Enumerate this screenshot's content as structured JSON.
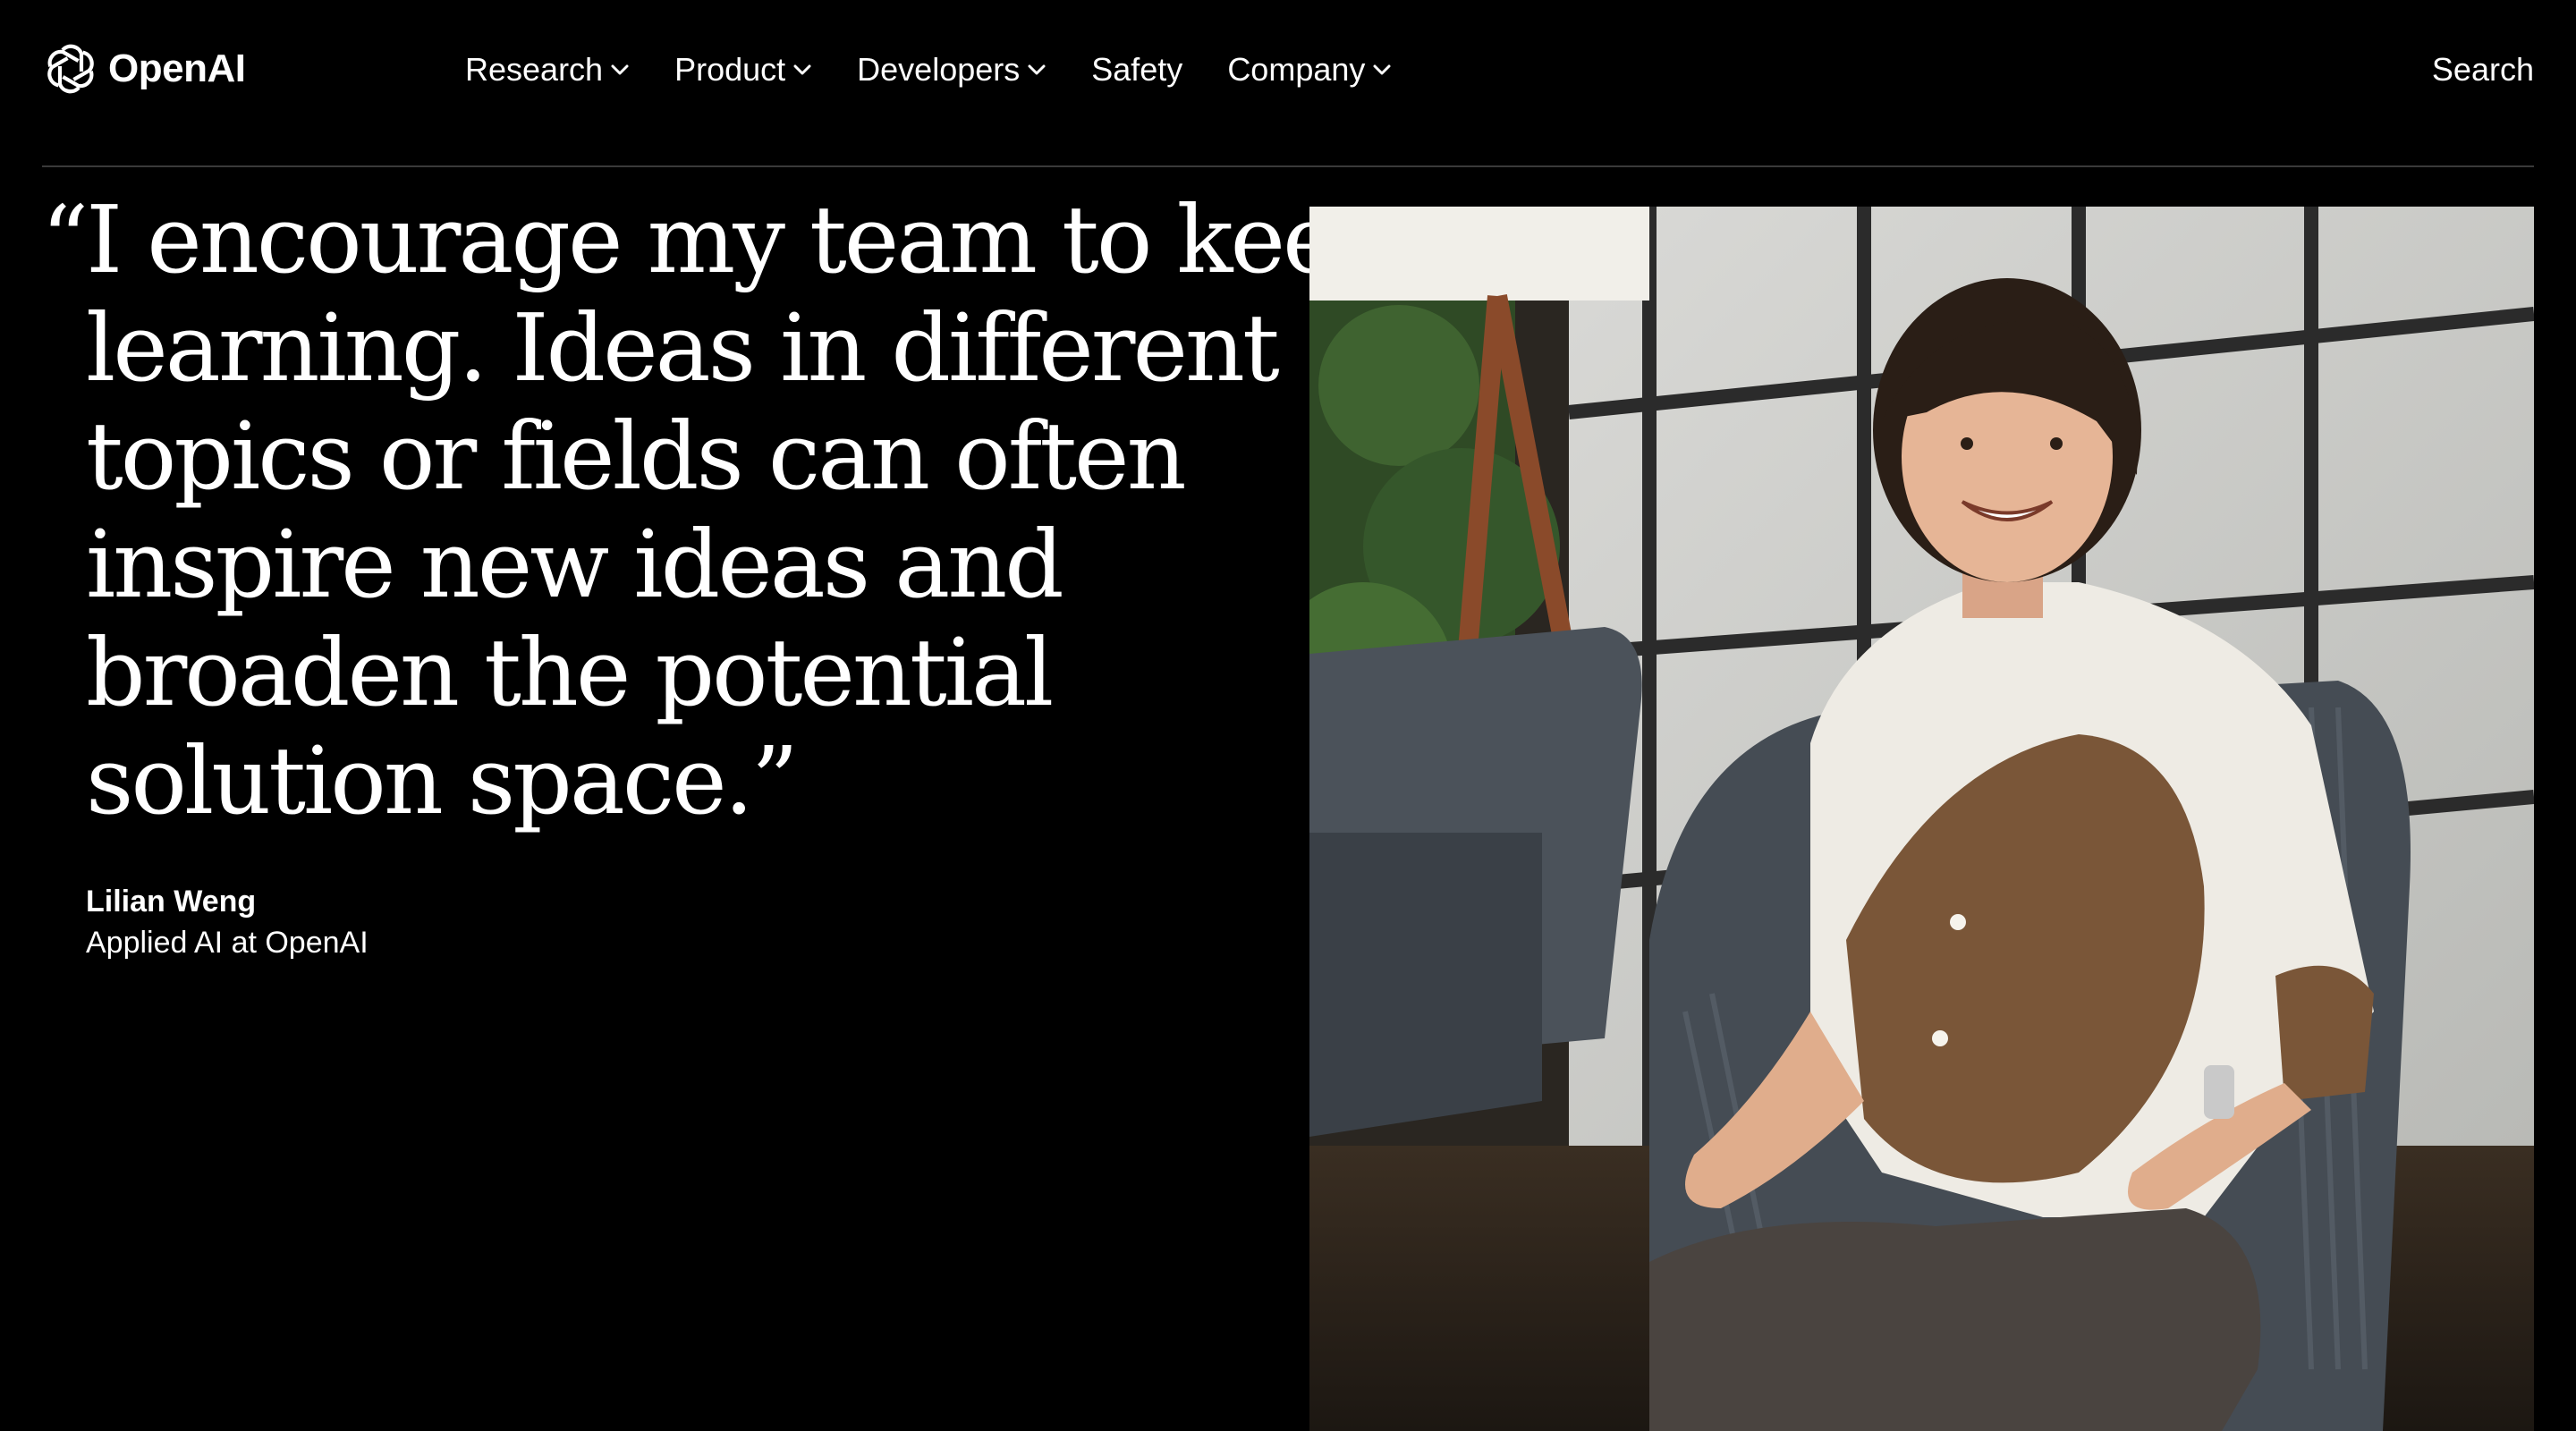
{
  "header": {
    "logo_text": "OpenAI",
    "nav": [
      {
        "label": "Research",
        "has_dropdown": true,
        "icon": "chevron-down-icon"
      },
      {
        "label": "Product",
        "has_dropdown": true,
        "icon": "chevron-down-icon"
      },
      {
        "label": "Developers",
        "has_dropdown": true,
        "icon": "chevron-down-icon"
      },
      {
        "label": "Safety",
        "has_dropdown": false
      },
      {
        "label": "Company",
        "has_dropdown": true,
        "icon": "chevron-down-icon"
      }
    ],
    "search_label": "Search"
  },
  "quote": {
    "lines": [
      "“I encourage my team to keep",
      "learning. Ideas in different",
      "topics or fields can often",
      "inspire new ideas and",
      "broaden the potential",
      "solution space.”"
    ],
    "author": "Lilian Weng",
    "role": "Applied AI at OpenAI"
  },
  "colors": {
    "background": "#000000",
    "text": "#ffffff",
    "divider": "#3a3a3a"
  }
}
